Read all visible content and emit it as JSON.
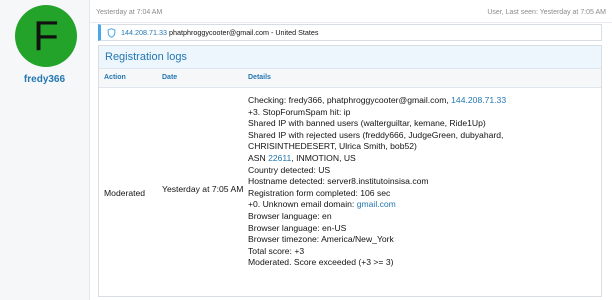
{
  "user": {
    "avatar_letter": "F",
    "name": "fredy366"
  },
  "meta": {
    "posted": "Yesterday at 7:04 AM",
    "last_seen": "User, Last seen: Yesterday at 7:05 AM"
  },
  "ip_bar": {
    "ip": "144.208.71.33",
    "email_location": "phatphroggycooter@gmail.com - United States"
  },
  "registration_logs": {
    "title": "Registration logs",
    "columns": {
      "action": "Action",
      "date": "Date",
      "details": "Details"
    },
    "row": {
      "action": "Moderated",
      "date": "Yesterday at 7:05 AM",
      "details": [
        {
          "text": "Checking: fredy366, phatphroggycooter@gmail.com, ",
          "link": "144.208.71.33"
        },
        {
          "text": "+3. StopForumSpam hit: ip"
        },
        {
          "text": "Shared IP with banned users (walterguiltar, kemane, Ride1Up)"
        },
        {
          "text": "Shared IP with rejected users (freddy666, JudgeGreen, dubyahard,"
        },
        {
          "text": "CHRISINTHEDESERT, Ulrica Smith, bob52)"
        },
        {
          "text": "ASN ",
          "link": "22611",
          "after": ", INMOTION, US"
        },
        {
          "text": "Country detected: US"
        },
        {
          "text": "Hostname detected: server8.institutoinsisa.com"
        },
        {
          "text": "Registration form completed: 106 sec"
        },
        {
          "text": "+0. Unknown email domain: ",
          "link": "gmail.com"
        },
        {
          "text": "Browser language: en"
        },
        {
          "text": "Browser language: en-US"
        },
        {
          "text": "Browser timezone: America/New_York"
        },
        {
          "text": "Total score: +3"
        },
        {
          "text": "Moderated. Score exceeded (+3 >= 3)"
        }
      ]
    }
  },
  "colors": {
    "avatar_bg": "#24a32a",
    "link": "#2577b1",
    "accent_bar": "#47a7eb",
    "panel_header_bg": "#edf6fd"
  },
  "icons": {
    "ip_bar": "shield-icon"
  }
}
